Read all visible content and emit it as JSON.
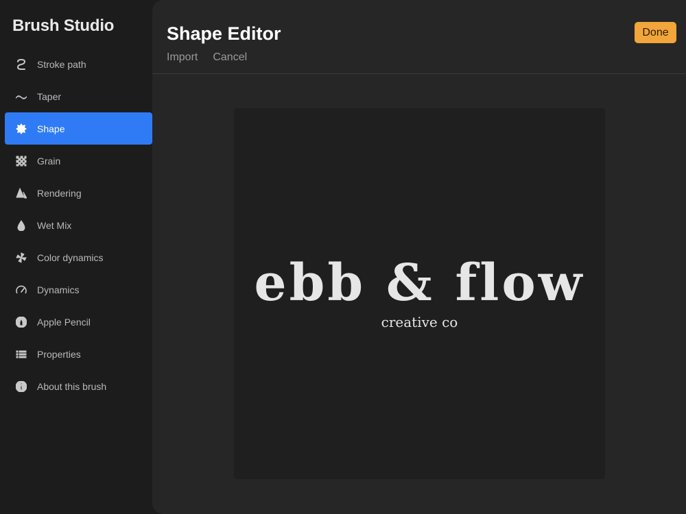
{
  "sidebar": {
    "title": "Brush Studio",
    "items": [
      {
        "label": "Stroke path",
        "icon": "stroke-path-icon"
      },
      {
        "label": "Taper",
        "icon": "taper-icon"
      },
      {
        "label": "Shape",
        "icon": "shape-icon",
        "selected": true
      },
      {
        "label": "Grain",
        "icon": "grain-icon"
      },
      {
        "label": "Rendering",
        "icon": "rendering-icon"
      },
      {
        "label": "Wet Mix",
        "icon": "wet-mix-icon"
      },
      {
        "label": "Color dynamics",
        "icon": "color-dynamics-icon"
      },
      {
        "label": "Dynamics",
        "icon": "dynamics-icon"
      },
      {
        "label": "Apple Pencil",
        "icon": "apple-pencil-icon"
      },
      {
        "label": "Properties",
        "icon": "properties-icon"
      },
      {
        "label": "About this brush",
        "icon": "info-icon"
      }
    ]
  },
  "editor": {
    "title": "Shape Editor",
    "import_label": "Import",
    "cancel_label": "Cancel",
    "done_label": "Done"
  },
  "shape": {
    "main_text": "ebb & flow",
    "sub_text": "creative co"
  },
  "colors": {
    "accent": "#2f7bf5",
    "done_button": "#f2a53a",
    "sidebar_bg": "#1c1c1c",
    "panel_bg": "#262626",
    "canvas_bg": "#1f1f1f"
  }
}
